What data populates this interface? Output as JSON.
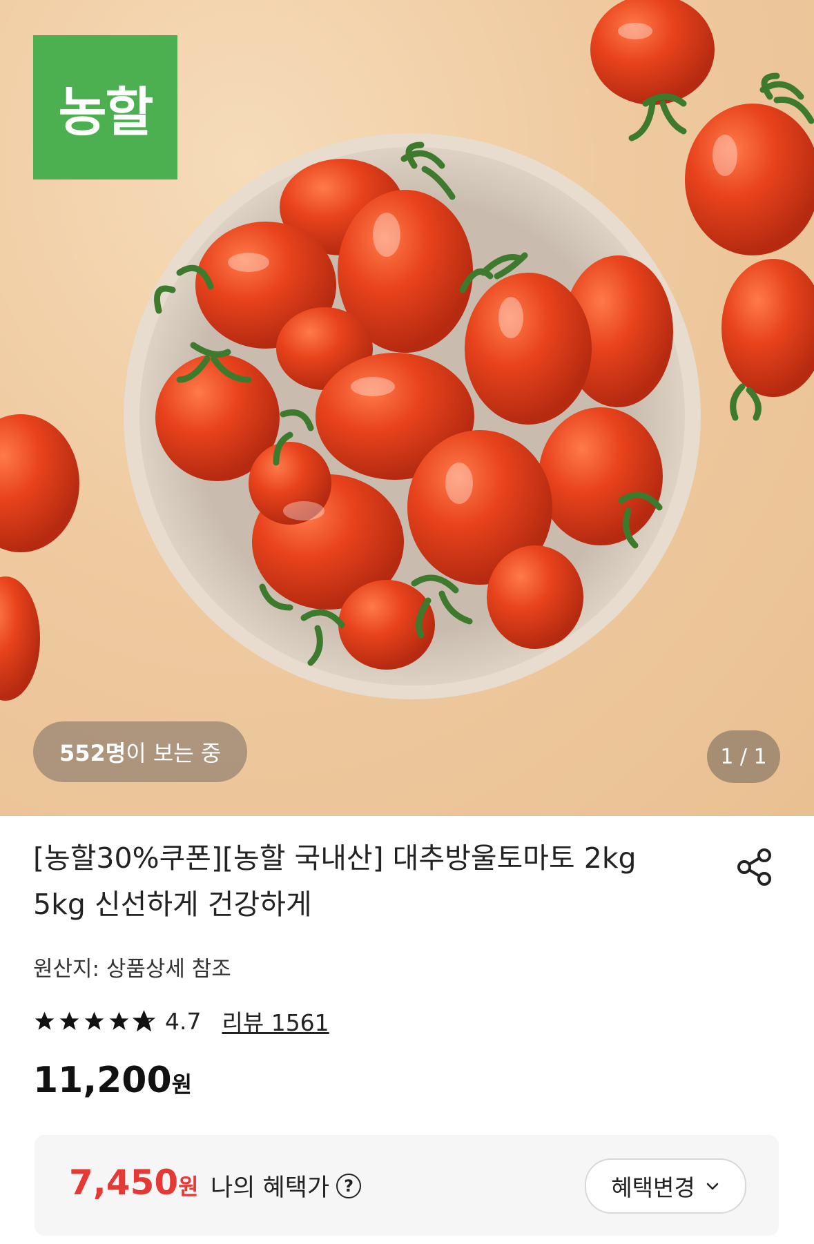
{
  "hero": {
    "logo_text": "농할",
    "viewers_count": "552명",
    "viewers_suffix": "이 보는 중",
    "pager": "1 / 1"
  },
  "product": {
    "title": "[농할30%쿠폰][농할 국내산] 대추방울토마토 2kg 5kg 신선하게 건강하게",
    "origin": "원산지: 상품상세 참조",
    "rating": "4.7",
    "stars": 4.7,
    "review_label": "리뷰 1561",
    "price": "11,200",
    "price_unit": "원"
  },
  "benefit": {
    "price": "7,450",
    "price_unit": "원",
    "label": "나의 혜택가",
    "help_icon": "?",
    "change_label": "혜택변경"
  },
  "colors": {
    "brand_green": "#4caf50",
    "benefit_red": "#e53935"
  },
  "icons": [
    "share-icon",
    "star-icon",
    "question-icon",
    "chevron-down-icon"
  ]
}
